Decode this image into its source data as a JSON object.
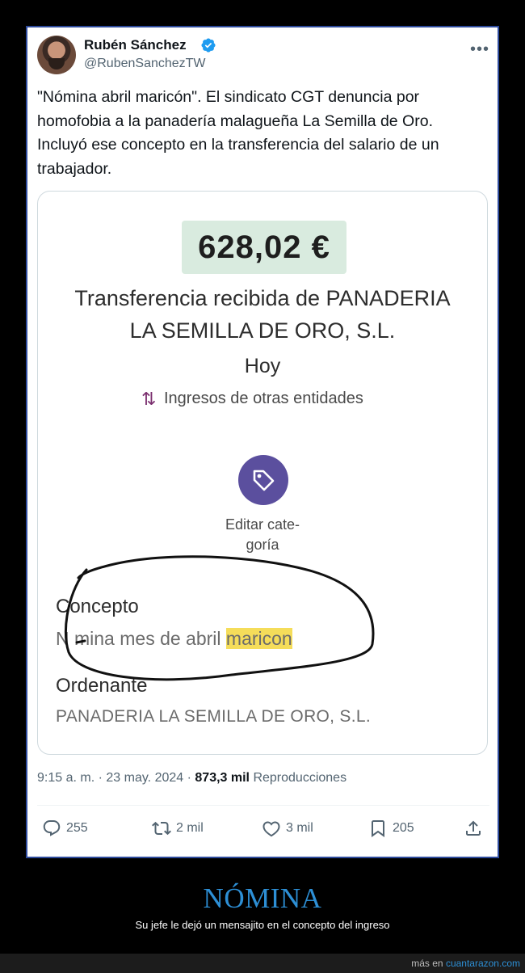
{
  "tweet": {
    "author_name": "Rubén Sánchez",
    "author_handle": "@RubenSanchezTW",
    "text": "\"Nómina abril maricón\". El sindicato CGT denuncia por homofobia a la panadería malagueña La Semilla de Oro. Incluyó ese concepto en la transferencia del salario de un trabajador.",
    "time": "9:15 a. m.",
    "date": "23 may. 2024",
    "separator": "·",
    "views_count": "873,3 mil",
    "views_label": "Reproducciones",
    "more_icon": "more-icon"
  },
  "media": {
    "amount": "628,02 €",
    "transfer_line1": "Transferencia recibida de PANADERIA",
    "transfer_line2": "LA SEMILLA DE ORO, S.L.",
    "date_label": "Hoy",
    "category": "Ingresos de otras entidades",
    "edit_line1": "Editar cate-",
    "edit_line2": "goría",
    "concepto_label": "Concepto",
    "concepto_value_start": "N mina mes de abril ",
    "concepto_value_highlight": "maricon",
    "ordenante_label": "Ordenante",
    "ordenante_value": "PANADERIA LA SEMILLA DE ORO, S.L."
  },
  "actions": {
    "replies": "255",
    "reposts": "2 mil",
    "likes": "3 mil",
    "bookmarks": "205"
  },
  "footer": {
    "title": "NÓMINA",
    "subtitle": "Su jefe le dejó un mensajito en el concepto del ingreso",
    "credit_prefix": "más en",
    "credit_site": "cuantarazon.com"
  },
  "colors": {
    "accent": "#2d8fd5",
    "tag_button": "#5b4f9e",
    "amount_bg": "#d9ebdf",
    "highlight": "#f5dd5a",
    "verified": "#1d9bf0"
  }
}
